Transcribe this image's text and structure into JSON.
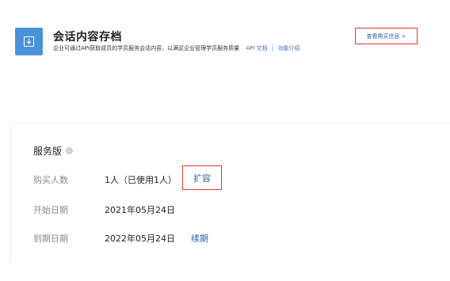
{
  "header": {
    "title": "会话内容存档",
    "description": "企业可通过API获取成员的学员服务会话内容，以满足企业管理学员服务质量",
    "api_doc_link": "API 文档",
    "separator": "|",
    "intro_link": "功能介绍",
    "purchase_button": "查看购买信息 >",
    "icon": "download-box-icon"
  },
  "plan": {
    "section_title": "服务版",
    "info_icon": "info-icon",
    "rows": [
      {
        "label": "购买人数",
        "value": "1人（已使用1人）",
        "action": "扩容"
      },
      {
        "label": "开始日期",
        "value": "2021年05月24日"
      },
      {
        "label": "到期日期",
        "value": "2022年05月24日",
        "action": "续期"
      }
    ]
  },
  "colors": {
    "accent_blue": "#2f5fa8",
    "icon_blue": "#4a92d8",
    "highlight_red": "#e53935"
  }
}
